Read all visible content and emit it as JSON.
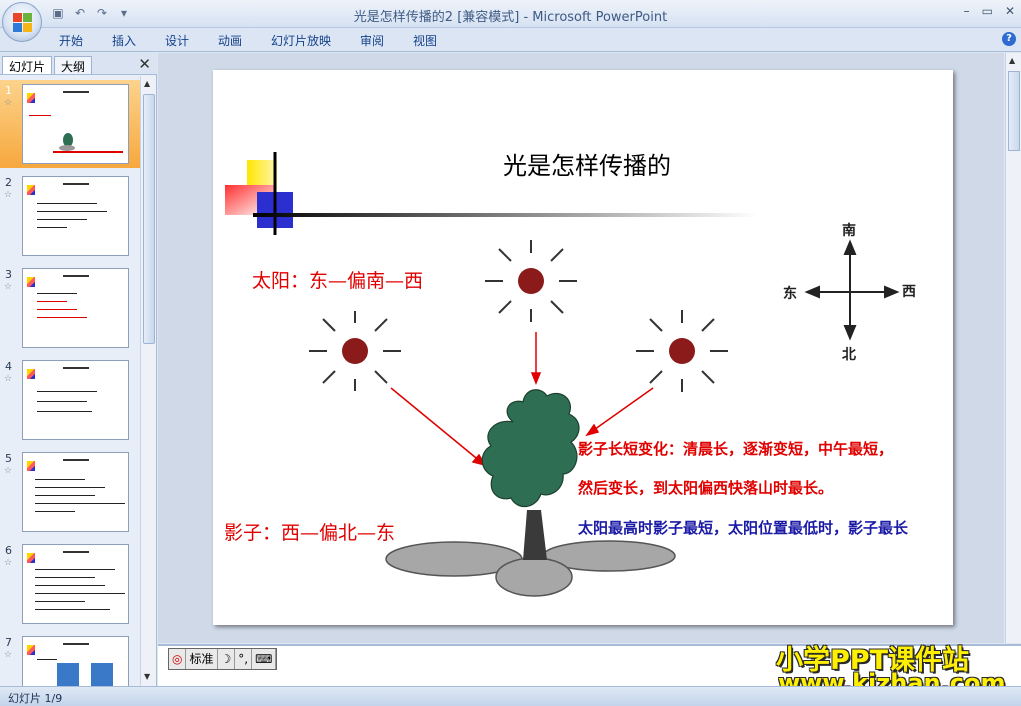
{
  "window": {
    "title": "光是怎样传播的2 [兼容模式] - Microsoft PowerPoint",
    "controls": [
      "–",
      "▭",
      "✕"
    ]
  },
  "ribbon": {
    "tabs": [
      "开始",
      "插入",
      "设计",
      "动画",
      "幻灯片放映",
      "审阅",
      "视图"
    ]
  },
  "left_pane": {
    "tabs": [
      "幻灯片",
      "大纲"
    ],
    "slides": [
      "1",
      "2",
      "3",
      "4",
      "5",
      "6",
      "7"
    ],
    "selected": "1"
  },
  "slide": {
    "title": "光是怎样传播的",
    "sun_label": "太阳：东—偏南—西",
    "shadow_label": "影子：西—偏北—东",
    "desc1": "影子长短变化：清晨长，逐渐变短，中午最短，",
    "desc2": "然后变长，到太阳偏西快落山时最长。",
    "desc3": "太阳最高时影子最短，太阳位置最低时，影子最长",
    "compass": {
      "north": "南",
      "south": "北",
      "east": "东",
      "west": "西"
    }
  },
  "ime": {
    "mode": "标准"
  },
  "watermark": {
    "line1": "小学PPT课件站",
    "line2": "www.kjzhan.com"
  },
  "status": {
    "slide_counter": "幻灯片 1/9"
  },
  "colors": {
    "red_text": "#e00000",
    "blue_text": "#1a1aa6",
    "sun": "#8b1a1a",
    "tree": "#2e6e52"
  }
}
